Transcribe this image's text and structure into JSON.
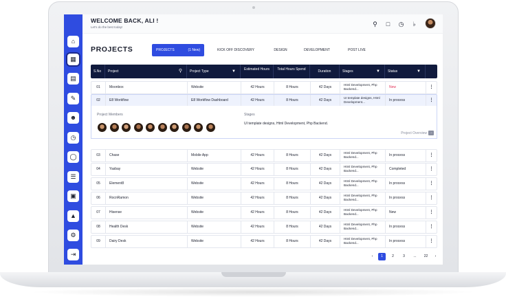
{
  "header": {
    "welcome": "WELCOME BACK, ALI !",
    "subtitle": "Let's do the best today!"
  },
  "icons": {
    "top": [
      "search-icon",
      "bookmark-icon",
      "timer-icon",
      "bell-icon"
    ],
    "sidebar": [
      "home-icon",
      "folder-icon",
      "calendar-icon",
      "edit-icon",
      "users-icon",
      "clock-icon",
      "shield-icon",
      "server-icon",
      "wallet-icon",
      "image-icon",
      "gear-icon",
      "logout-icon"
    ]
  },
  "page": {
    "title": "PROJECTS",
    "tabs": [
      {
        "label": "PROJECTS",
        "count": "(1 New)"
      },
      {
        "label": "KICK OFF DISCOVERY",
        "count": ""
      },
      {
        "label": "DESIGN",
        "count": ""
      },
      {
        "label": "DEVELOPMENT",
        "count": ""
      },
      {
        "label": "POST LIVE",
        "count": ""
      }
    ]
  },
  "table": {
    "headers": [
      "S.No",
      "Project",
      "Project Type",
      "Estimated Hours",
      "Total Hours Spend",
      "Duration",
      "Stages",
      "Status"
    ],
    "rows": [
      {
        "no": "01",
        "project": "Moonbox",
        "type": "Website",
        "est": "42 Hours",
        "spent": "8 Hours",
        "duration": "42 Days",
        "stages": "Html Development, Php Backend...",
        "status": "New"
      },
      {
        "no": "02",
        "project": "E8 Workflow",
        "type": "E8 Workflow Dashboard",
        "est": "42 Hours",
        "spent": "8 Hours",
        "duration": "42 Days",
        "stages": "UI template designs, Html Development...",
        "status": "In process"
      },
      {
        "no": "03",
        "project": "Chase",
        "type": "Mobile App",
        "est": "42 Hours",
        "spent": "8 Hours",
        "duration": "42 Days",
        "stages": "Html Development, Php Backend...",
        "status": "In process"
      },
      {
        "no": "04",
        "project": "Yasbay",
        "type": "Website",
        "est": "42 Hours",
        "spent": "8 Hours",
        "duration": "42 Days",
        "stages": "Html Development, Php Backend...",
        "status": "Completed"
      },
      {
        "no": "05",
        "project": "Element8",
        "type": "Website",
        "est": "42 Hours",
        "spent": "8 Hours",
        "duration": "42 Days",
        "stages": "Html Development, Php Backend...",
        "status": "In process"
      },
      {
        "no": "06",
        "project": "RocnRamon",
        "type": "Website",
        "est": "42 Hours",
        "spent": "8 Hours",
        "duration": "42 Days",
        "stages": "Html Development, Php Backend...",
        "status": "In process"
      },
      {
        "no": "07",
        "project": "Hisense",
        "type": "Website",
        "est": "42 Hours",
        "spent": "8 Hours",
        "duration": "42 Days",
        "stages": "Html Development, Php Backend...",
        "status": "New"
      },
      {
        "no": "08",
        "project": "Health Desk",
        "type": "Website",
        "est": "42 Hours",
        "spent": "8 Hours",
        "duration": "42 Days",
        "stages": "Html Development, Php Backend...",
        "status": "In process"
      },
      {
        "no": "09",
        "project": "Dairy Desk",
        "type": "Website",
        "est": "42 Hours",
        "spent": "8 Hours",
        "duration": "42 Days",
        "stages": "Html Development, Php Backend...",
        "status": "In process"
      }
    ],
    "detail": {
      "members_label": "Project Members",
      "stages_label": "Stages",
      "stages_text": "UI template designs, Html Development, Php Backend.",
      "overview": "Project Overview"
    }
  },
  "pagination": {
    "pages": [
      "1",
      "2",
      "3",
      "...",
      "22"
    ],
    "current": "1"
  },
  "colors": {
    "accent": "#2f4ce0",
    "header_dark": "#101a3d",
    "new_status": "#e2345a"
  }
}
